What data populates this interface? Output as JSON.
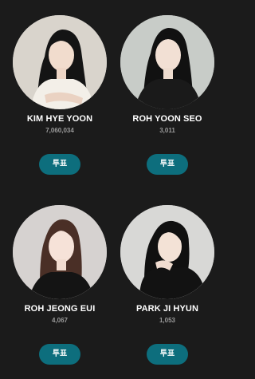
{
  "candidates": [
    {
      "name": "KIM HYE YOON",
      "votes": "7,060,034",
      "vote_label": "투표"
    },
    {
      "name": "ROH YOON SEO",
      "votes": "3,011",
      "vote_label": "투표"
    },
    {
      "name": "ROH JEONG EUI",
      "votes": "4,067",
      "vote_label": "투표"
    },
    {
      "name": "PARK JI HYUN",
      "votes": "1,053",
      "vote_label": "투표"
    }
  ],
  "colors": {
    "background": "#1b1b1b",
    "button": "#0d6e7d",
    "name_text": "#ffffff",
    "count_text": "#9a9a9a"
  }
}
